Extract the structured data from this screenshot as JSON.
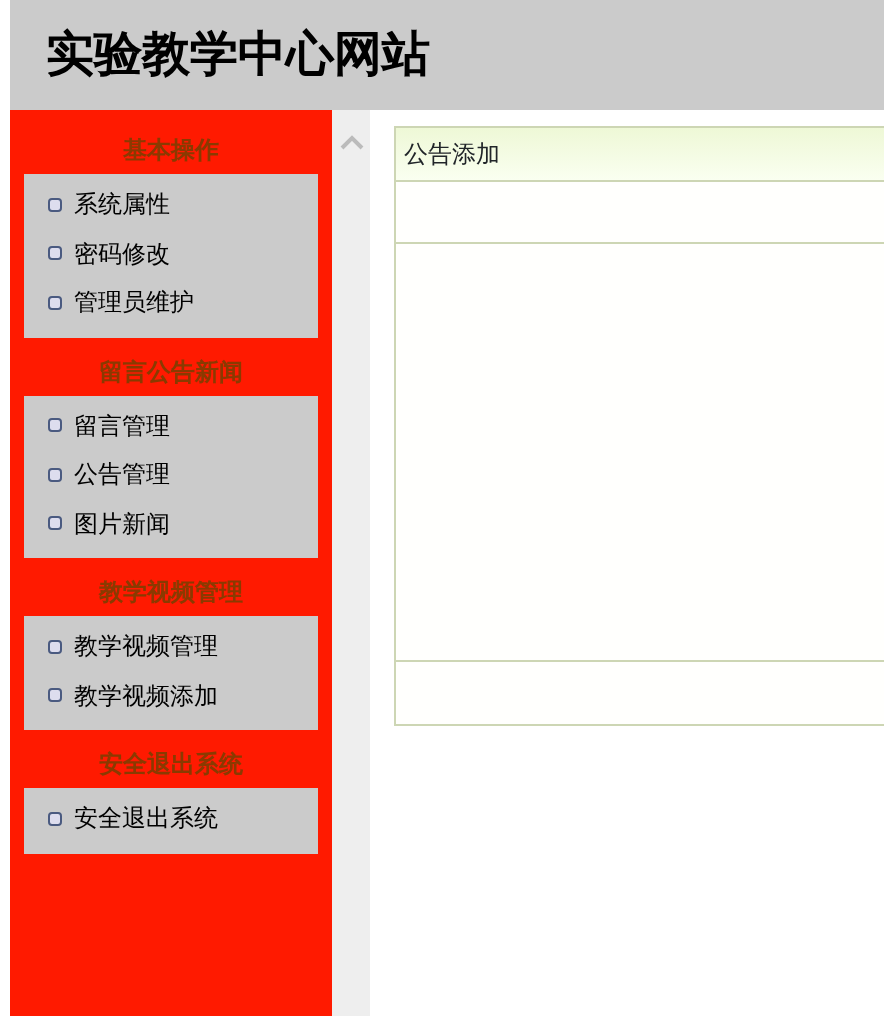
{
  "header": {
    "title": "实验教学中心网站"
  },
  "sidebar": {
    "sections": [
      {
        "heading": "基本操作",
        "items": [
          "系统属性",
          "密码修改",
          "管理员维护"
        ]
      },
      {
        "heading": "留言公告新闻",
        "items": [
          "留言管理",
          "公告管理",
          "图片新闻"
        ]
      },
      {
        "heading": "教学视频管理",
        "items": [
          "教学视频管理",
          "教学视频添加"
        ]
      },
      {
        "heading": "安全退出系统",
        "items": [
          "安全退出系统"
        ]
      }
    ]
  },
  "panel": {
    "title": "公告添加"
  }
}
